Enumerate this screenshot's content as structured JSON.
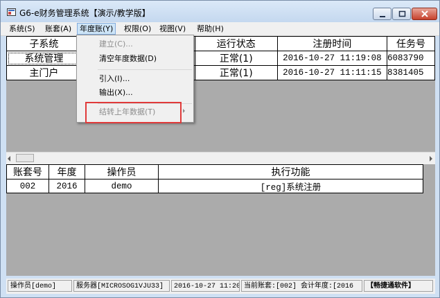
{
  "window": {
    "title": "G6-e财务管理系统【演示/教学版】"
  },
  "menubar": {
    "items": [
      {
        "label": "系统(S)"
      },
      {
        "label": "账套(A)"
      },
      {
        "label": "年度账(Y)"
      },
      {
        "label": "权限(O)"
      },
      {
        "label": "视图(V)"
      },
      {
        "label": "帮助(H)"
      }
    ]
  },
  "year_menu": {
    "items": [
      {
        "label": "建立(C)...",
        "enabled": false
      },
      {
        "label": "清空年度数据(D)",
        "enabled": true
      },
      {
        "label": "引入(I)...",
        "enabled": true
      },
      {
        "label": "输出(X)...",
        "enabled": true
      },
      {
        "label": "结转上年数据(T)",
        "enabled": false,
        "submenu": true
      }
    ]
  },
  "subsystem_table": {
    "headers": [
      "子系统",
      "",
      "运行状态",
      "注册时间",
      "任务号"
    ],
    "rows": [
      [
        "系统管理",
        "",
        "正常(1)",
        "2016-10-27 11:19:08",
        "6083790"
      ],
      [
        "主门户",
        "",
        "正常(1)",
        "2016-10-27 11:11:15",
        "8381405"
      ]
    ]
  },
  "log_table": {
    "headers": [
      "账套号",
      "年度",
      "操作员",
      "执行功能"
    ],
    "rows": [
      [
        "002",
        "2016",
        "demo",
        "[reg]系统注册"
      ]
    ]
  },
  "statusbar": {
    "operator": "操作员[demo]",
    "server": "服务器[MICROSOG1VJU33]",
    "datetime": "2016-10-27 11:20",
    "current_account": "当前账套:[002] 会计年度:[2016",
    "brand": "【畅捷通软件】"
  },
  "colors": {
    "highlight_box": "#e03a3a",
    "grid_background": "#ababab",
    "menu_active": "#cde4f7"
  }
}
